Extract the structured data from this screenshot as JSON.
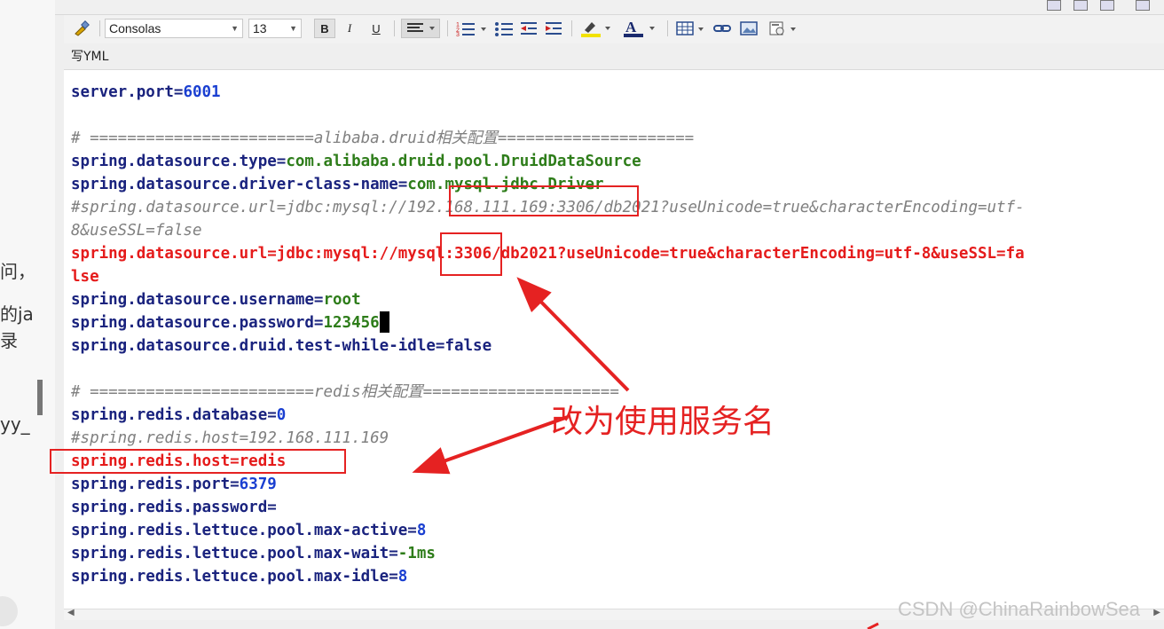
{
  "left_panel": {
    "fragments": [
      "问，",
      "的ja",
      "录",
      "yy_"
    ]
  },
  "toolbar": {
    "font_family": "Consolas",
    "font_size": "13",
    "bold_label": "B",
    "italic_label": "I",
    "underline_label": "U"
  },
  "editor": {
    "content_label": "写YML"
  },
  "code_lines": [
    [
      {
        "t": "server.port=",
        "c": "k"
      },
      {
        "t": "6001",
        "c": "n"
      }
    ],
    [],
    [
      {
        "t": "# ========================alibaba.druid相关配置=====================",
        "c": "c"
      }
    ],
    [
      {
        "t": "spring.datasource.type=",
        "c": "k"
      },
      {
        "t": "com.alibaba.druid.pool.DruidDataSource",
        "c": "v"
      }
    ],
    [
      {
        "t": "spring.datasource.driver-class-name=",
        "c": "k"
      },
      {
        "t": "com.mysql.jdbc.Driver",
        "c": "v"
      }
    ],
    [
      {
        "t": "#spring.datasource.url=jdbc:mysql://192.168.111.169:3306/db2021?useUnicode=true&characterEncoding=utf-",
        "c": "c"
      }
    ],
    [
      {
        "t": "8&useSSL=false",
        "c": "c"
      }
    ],
    [
      {
        "t": "spring.datasource.url=jdbc:mysql://mysql:3306/db2021?useUnicode=true&characterEncoding=utf-8&useSSL=fa",
        "c": "r"
      }
    ],
    [
      {
        "t": "lse",
        "c": "r"
      }
    ],
    [
      {
        "t": "spring.datasource.username=",
        "c": "k"
      },
      {
        "t": "root",
        "c": "v"
      }
    ],
    [
      {
        "t": "spring.datasource.password=",
        "c": "k"
      },
      {
        "t": "123456",
        "c": "v"
      },
      {
        "t": "",
        "c": "cursor"
      }
    ],
    [
      {
        "t": "spring.datasource.druid.test-while-idle=",
        "c": "k"
      },
      {
        "t": "false",
        "c": "k"
      }
    ],
    [],
    [
      {
        "t": "# ========================redis相关配置=====================",
        "c": "c"
      }
    ],
    [
      {
        "t": "spring.redis.database=",
        "c": "k"
      },
      {
        "t": "0",
        "c": "n"
      }
    ],
    [
      {
        "t": "#spring.redis.host=192.168.111.169",
        "c": "c"
      }
    ],
    [
      {
        "t": "spring.redis.host=redis",
        "c": "r"
      }
    ],
    [
      {
        "t": "spring.redis.port=",
        "c": "k"
      },
      {
        "t": "6379",
        "c": "n"
      }
    ],
    [
      {
        "t": "spring.redis.password=",
        "c": "k"
      }
    ],
    [
      {
        "t": "spring.redis.lettuce.pool.max-active=",
        "c": "k"
      },
      {
        "t": "8",
        "c": "n"
      }
    ],
    [
      {
        "t": "spring.redis.lettuce.pool.max-wait=",
        "c": "k"
      },
      {
        "t": "-1ms",
        "c": "v"
      }
    ],
    [
      {
        "t": "spring.redis.lettuce.pool.max-idle=",
        "c": "k"
      },
      {
        "t": "8",
        "c": "n"
      }
    ]
  ],
  "annotation": {
    "text": "改为使用服务名",
    "color": "#e52222"
  },
  "watermark": "CSDN @ChinaRainbowSea"
}
